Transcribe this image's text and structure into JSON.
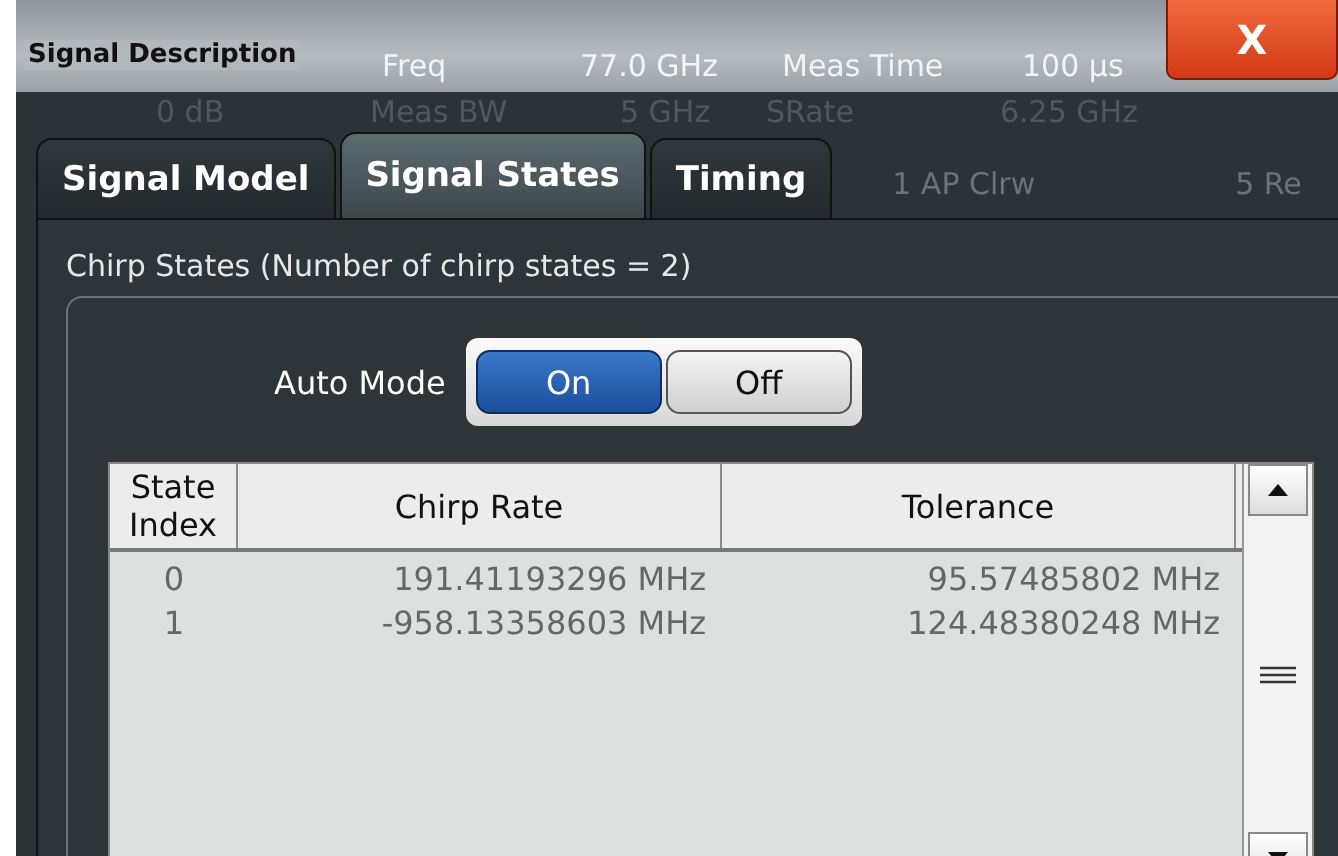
{
  "window": {
    "title": "Signal Description",
    "close_label": "X"
  },
  "background_readouts_upper": [
    "Freq",
    "77.0 GHz",
    "Meas Time",
    "100 µs"
  ],
  "background_readouts_lower": [
    "0 dB",
    "Meas BW",
    "5 GHz",
    "SRate",
    "6.25 GHz"
  ],
  "background_traces": [
    {
      "text": "1 AP Clrw"
    },
    {
      "text": "5 Re"
    }
  ],
  "tabs": [
    {
      "label": "Signal Model",
      "selected": false
    },
    {
      "label": "Signal States",
      "selected": true
    },
    {
      "label": "Timing",
      "selected": false
    }
  ],
  "group": {
    "label": "Chirp States (Number of chirp states = 2)",
    "auto_mode": {
      "label": "Auto Mode",
      "options": [
        {
          "label": "On",
          "selected": true
        },
        {
          "label": "Off",
          "selected": false
        }
      ]
    },
    "table": {
      "columns": [
        "State Index",
        "Chirp Rate",
        "Tolerance"
      ],
      "rows": [
        [
          "0",
          "191.41193296 MHz",
          "95.57485802 MHz"
        ],
        [
          "1",
          "-958.13358603 MHz",
          "124.48380248 MHz"
        ]
      ]
    }
  }
}
